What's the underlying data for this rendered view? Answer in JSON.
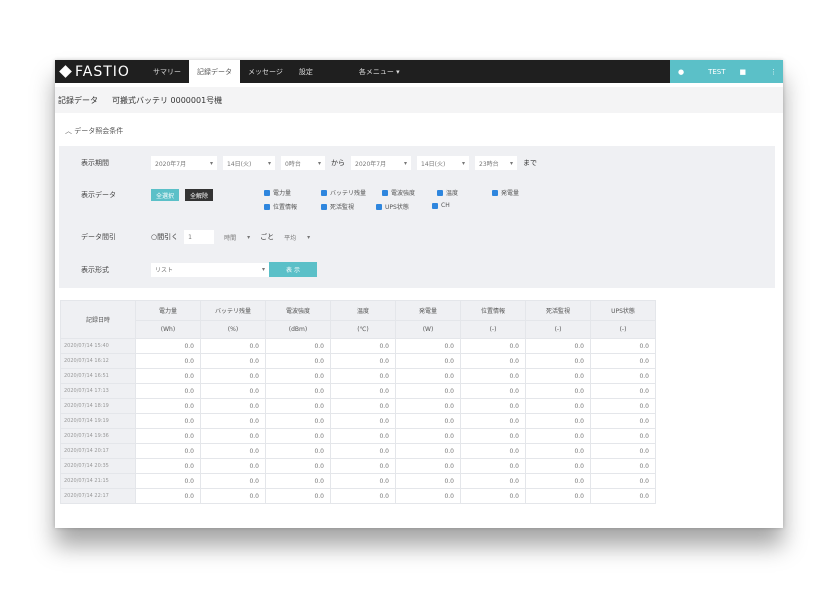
{
  "header": {
    "logo": "FASTIO",
    "nav": [
      "サマリー",
      "記録データ",
      "メッセージ",
      "設定",
      "各メニュー ▾"
    ],
    "user": "TEST"
  },
  "title": {
    "section": "記録データ",
    "device": "可搬式バッテリ 0000001号機"
  },
  "conditions": {
    "toggle": "データ照会条件",
    "period_label": "表示期間",
    "from": [
      "2020年7月",
      "14日(火)",
      "0時台"
    ],
    "from_suffix": "から",
    "to": [
      "2020年7月",
      "14日(火)",
      "23時台"
    ],
    "to_suffix": "まで",
    "data_label": "表示データ",
    "select_all": "全選択",
    "deselect_all": "全解除",
    "items": [
      "電力量",
      "バッテリ残量",
      "電波強度",
      "温度",
      "発電量",
      "位置情報",
      "死活監視",
      "UPS状態",
      "CH"
    ],
    "interval_label": "データ間引",
    "interval_check": "間引く",
    "interval_value": "1",
    "interval_unit": "時間",
    "interval_mid": "ごと",
    "interval_pos": "平均",
    "format_label": "表示形式",
    "format_value": "リスト",
    "show": "表 示"
  },
  "table": {
    "time_header": "記録日時",
    "columns": [
      {
        "name": "電力量",
        "unit": "(Wh)"
      },
      {
        "name": "バッテリ残量",
        "unit": "(%)"
      },
      {
        "name": "電波強度",
        "unit": "(dBm)"
      },
      {
        "name": "温度",
        "unit": "(℃)"
      },
      {
        "name": "発電量",
        "unit": "(W)"
      },
      {
        "name": "位置情報",
        "unit": "(-)"
      },
      {
        "name": "死活監視",
        "unit": "(-)"
      },
      {
        "name": "UPS状態",
        "unit": "(-)"
      }
    ],
    "rows": [
      "2020/07/14 15:40",
      "2020/07/14 16:12",
      "2020/07/14 16:51",
      "2020/07/14 17:13",
      "2020/07/14 18:19",
      "2020/07/14 19:19",
      "2020/07/14 19:36",
      "2020/07/14 20:17",
      "2020/07/14 20:35",
      "2020/07/14 21:15",
      "2020/07/14 22:17"
    ],
    "value": "0.0"
  }
}
